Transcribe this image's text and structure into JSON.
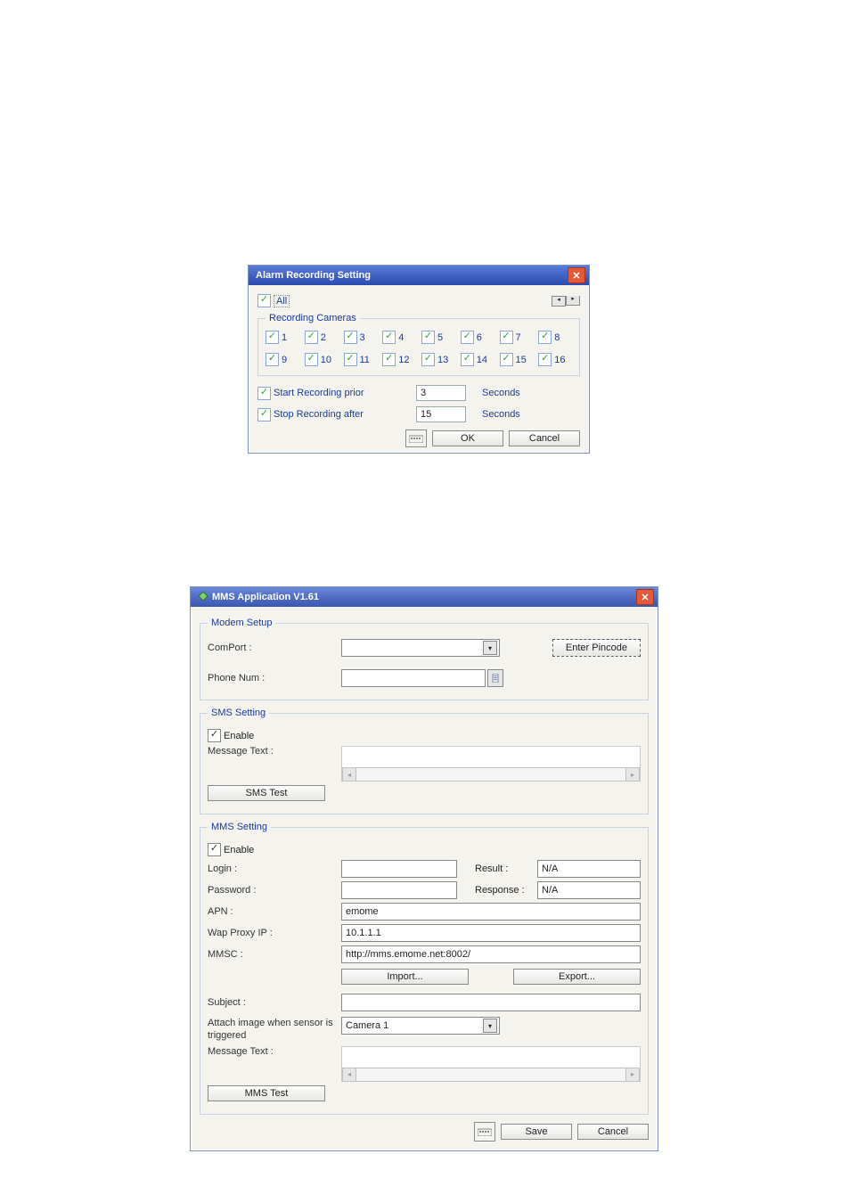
{
  "win1": {
    "title": "Alarm Recording Setting",
    "all_label": "All",
    "all_checked": true,
    "group_label": "Recording Cameras",
    "cameras": [
      {
        "n": "1",
        "c": true
      },
      {
        "n": "2",
        "c": true
      },
      {
        "n": "3",
        "c": true
      },
      {
        "n": "4",
        "c": true
      },
      {
        "n": "5",
        "c": true
      },
      {
        "n": "6",
        "c": true
      },
      {
        "n": "7",
        "c": true
      },
      {
        "n": "8",
        "c": true
      },
      {
        "n": "9",
        "c": true
      },
      {
        "n": "10",
        "c": true
      },
      {
        "n": "11",
        "c": true
      },
      {
        "n": "12",
        "c": true
      },
      {
        "n": "13",
        "c": true
      },
      {
        "n": "14",
        "c": true
      },
      {
        "n": "15",
        "c": true
      },
      {
        "n": "16",
        "c": true
      }
    ],
    "start_label": "Start Recording prior",
    "start_checked": true,
    "start_value": "3",
    "stop_label": "Stop Recording after",
    "stop_checked": true,
    "stop_value": "15",
    "seconds_label": "Seconds",
    "ok": "OK",
    "cancel": "Cancel"
  },
  "win2": {
    "title": "MMS Application V1.61",
    "modem_group": "Modem Setup",
    "comport_label": "ComPort :",
    "comport_value": "",
    "enter_pin": "Enter Pincode",
    "phone_label": "Phone Num :",
    "phone_value": "",
    "sms_group": "SMS Setting",
    "sms_enable_label": "Enable",
    "sms_enable_checked": true,
    "sms_msg_label": "Message Text :",
    "sms_msg_value": "",
    "sms_test": "SMS Test",
    "mms_group": "MMS Setting",
    "mms_enable_label": "Enable",
    "mms_enable_checked": true,
    "login_label": "Login :",
    "login_value": "",
    "result_label": "Result :",
    "result_value": "N/A",
    "password_label": "Password :",
    "password_value": "",
    "response_label": "Response :",
    "response_value": "N/A",
    "apn_label": "APN :",
    "apn_value": "emome",
    "wap_label": "Wap Proxy IP :",
    "wap_value": "10.1.1.1",
    "mmsc_label": "MMSC :",
    "mmsc_value": "http://mms.emome.net:8002/",
    "import": "Import...",
    "export": "Export...",
    "subject_label": "Subject :",
    "subject_value": "",
    "attach_label": "Attach image when sensor is triggered",
    "attach_camera": "Camera 1",
    "mms_msg_label": "Message Text :",
    "mms_msg_value": "",
    "mms_test": "MMS Test",
    "save": "Save",
    "cancel": "Cancel"
  }
}
